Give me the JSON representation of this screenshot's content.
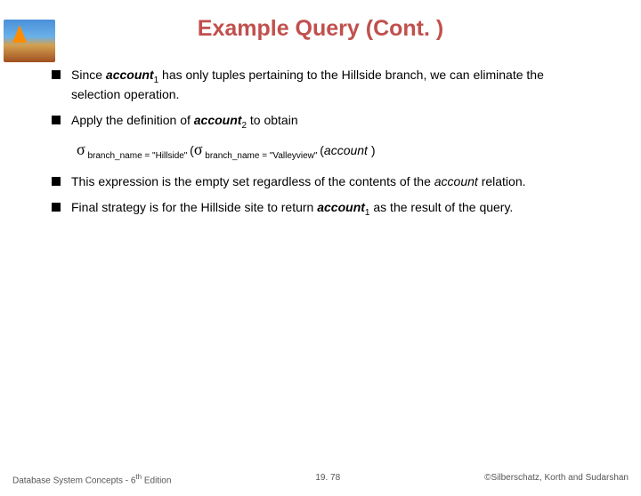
{
  "title": "Example Query (Cont. )",
  "bullets": {
    "b1_pre": "Since ",
    "b1_acc": "account",
    "b1_sub": "1",
    "b1_post": " has only tuples pertaining to the Hillside branch, we can eliminate the selection operation.",
    "b2_pre": "Apply the definition of ",
    "b2_acc": "account",
    "b2_sub": "2",
    "b2_post": " to obtain",
    "b3_pre": "This expression is the empty set regardless of the contents of the ",
    "b3_acc": "account",
    "b3_post": " relation.",
    "b4_pre": "Final strategy is for the Hillside site to return ",
    "b4_acc": "account",
    "b4_sub": "1",
    "b4_post": " as the result of the query."
  },
  "formula": {
    "sigma": "σ",
    "sub1": " branch_name = \"Hillside\" ",
    "open": "(",
    "sub2": " branch_name = \"Valleyview\" ",
    "open2": "(",
    "account": "account ",
    "close": ")"
  },
  "footer": {
    "left_pre": "Database System Concepts - 6",
    "left_sup": "th",
    "left_post": " Edition",
    "center": "19. 78",
    "right": "©Silberschatz, Korth and Sudarshan"
  }
}
